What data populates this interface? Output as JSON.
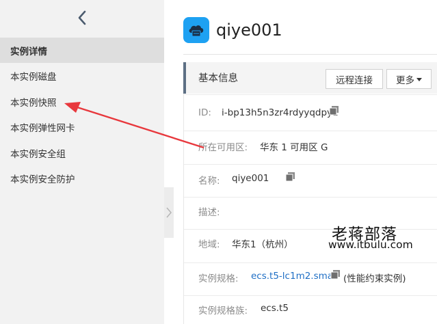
{
  "sidebar": {
    "collapse_icon": "chevron-left-icon",
    "items": [
      {
        "label": "实例详情",
        "active": true
      },
      {
        "label": "本实例磁盘"
      },
      {
        "label": "本实例快照"
      },
      {
        "label": "本实例弹性网卡"
      },
      {
        "label": "本实例安全组"
      },
      {
        "label": "本实例安全防护"
      }
    ]
  },
  "header": {
    "instance_name": "qiye001",
    "icon": "cloud-server-icon"
  },
  "panel": {
    "title": "基本信息",
    "buttons": {
      "remote": "远程连接",
      "more": "更多"
    },
    "rows": [
      {
        "label": "ID:",
        "value": "i-bp13h5n3zr4rdyyqdpy1"
      },
      {
        "label": "所在可用区:",
        "value": "华东 1 可用区 G"
      },
      {
        "label": "名称:",
        "value": "qiye001"
      },
      {
        "label": "描述:",
        "value": ""
      },
      {
        "label": "地域:",
        "value": "华东1（杭州）"
      },
      {
        "label": "实例规格:",
        "value": "ecs.t5-lc1m2.small",
        "note": "(性能约束实例)"
      },
      {
        "label": "实例规格族:",
        "value": "ecs.t5"
      }
    ]
  },
  "watermark": {
    "text": "老蒋部落",
    "url": "www.itbulu.com"
  },
  "colors": {
    "accent": "#1ea1f2",
    "link": "#1f6fc5",
    "arrow": "#e8383d",
    "panel_bar": "#5d6f84"
  }
}
